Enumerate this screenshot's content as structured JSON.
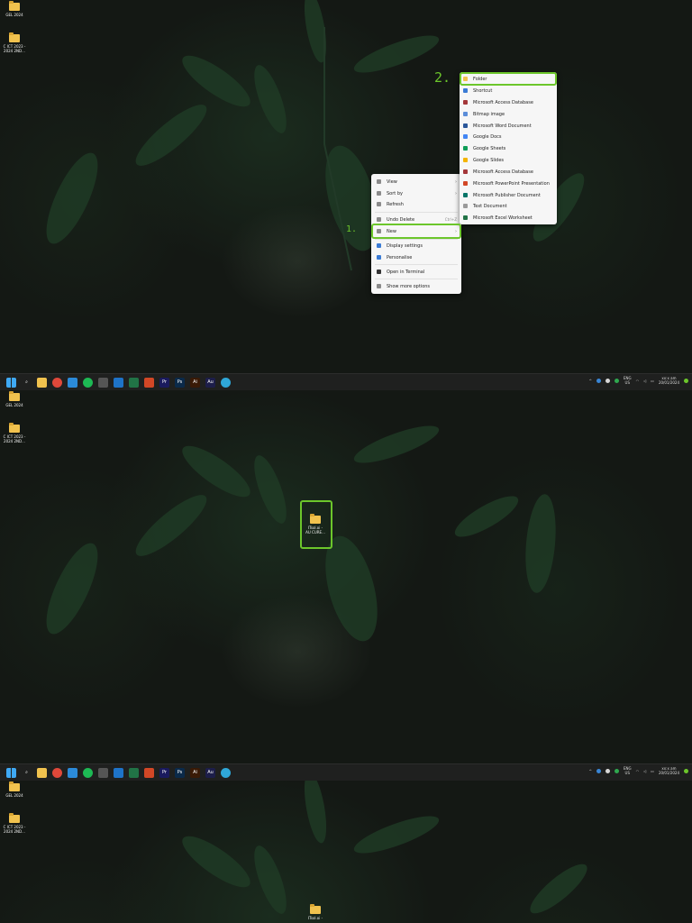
{
  "desktop_icons": [
    {
      "label": "GEL 2024"
    },
    {
      "label": "C ICT 2023 -\n2024 2ND..."
    }
  ],
  "context_menu": {
    "items": [
      {
        "label": "View",
        "shortcut": "",
        "arrow": "›"
      },
      {
        "label": "Sort by",
        "shortcut": "",
        "arrow": "›"
      },
      {
        "label": "Refresh",
        "shortcut": "",
        "arrow": ""
      },
      {
        "label": "Undo Delete",
        "shortcut": "Ctrl+Z",
        "arrow": ""
      },
      {
        "label": "New",
        "shortcut": "",
        "arrow": "›"
      },
      {
        "label": "Display settings",
        "shortcut": "",
        "arrow": ""
      },
      {
        "label": "Personalise",
        "shortcut": "",
        "arrow": ""
      },
      {
        "label": "Open in Terminal",
        "shortcut": "",
        "arrow": ""
      },
      {
        "label": "Show more options",
        "shortcut": "",
        "arrow": ""
      }
    ]
  },
  "new_submenu": {
    "items": [
      {
        "label": "Folder",
        "color": "#f1c24e"
      },
      {
        "label": "Shortcut",
        "color": "#3a7bd5"
      },
      {
        "label": "Microsoft Access Database",
        "color": "#a4373a"
      },
      {
        "label": "Bitmap image",
        "color": "#5b8dd9"
      },
      {
        "label": "Microsoft Word Document",
        "color": "#2b579a"
      },
      {
        "label": "Google Docs",
        "color": "#4285f4"
      },
      {
        "label": "Google Sheets",
        "color": "#0f9d58"
      },
      {
        "label": "Google Slides",
        "color": "#f4b400"
      },
      {
        "label": "Microsoft Access Database",
        "color": "#a4373a"
      },
      {
        "label": "Microsoft PowerPoint Presentation",
        "color": "#d24726"
      },
      {
        "label": "Microsoft Publisher Document",
        "color": "#077568"
      },
      {
        "label": "Text Document",
        "color": "#9a9a9a"
      },
      {
        "label": "Microsoft Excel Worksheet",
        "color": "#217346"
      }
    ]
  },
  "annotations": {
    "step1": "1.",
    "step2": "2."
  },
  "new_folder_labels": {
    "panel2": "ITsol.oi -\nAU CURE...",
    "panel3": "ITsol.oi -"
  },
  "taskbar": {
    "icons": [
      {
        "name": "start",
        "color": "#3fa9f5",
        "text": ""
      },
      {
        "name": "search",
        "color": "#1f201f",
        "text": "⌕"
      },
      {
        "name": "file-explorer",
        "color": "#f1c24e",
        "text": ""
      },
      {
        "name": "chrome",
        "color": "#e0483a",
        "text": ""
      },
      {
        "name": "vscode",
        "color": "#2b8ad9",
        "text": ""
      },
      {
        "name": "spotify",
        "color": "#1db954",
        "text": ""
      },
      {
        "name": "app",
        "color": "#555555",
        "text": ""
      },
      {
        "name": "outlook",
        "color": "#1e73c8",
        "text": ""
      },
      {
        "name": "excel",
        "color": "#217346",
        "text": ""
      },
      {
        "name": "powerpoint",
        "color": "#d24726",
        "text": ""
      },
      {
        "name": "premiere",
        "color": "#1a1a5e",
        "text": "Pr"
      },
      {
        "name": "photoshop",
        "color": "#0b2a4a",
        "text": "Ps"
      },
      {
        "name": "illustrator",
        "color": "#3a1a06",
        "text": "Ai"
      },
      {
        "name": "audition",
        "color": "#1d1e4a",
        "text": "Au"
      },
      {
        "name": "edge",
        "color": "#2fa7d8",
        "text": ""
      }
    ],
    "language": "ENG\nUS",
    "clock": "xx:x am\n20/01/2024"
  }
}
